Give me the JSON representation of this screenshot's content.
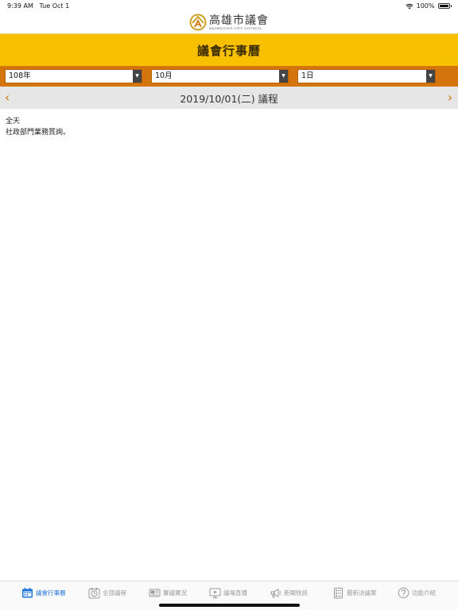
{
  "status_bar": {
    "time": "9:39 AM",
    "date": "Tue Oct 1",
    "battery": "100%"
  },
  "logo": {
    "chinese": "高雄市議會",
    "english": "KAOHSIUNG CITY COUNCIL"
  },
  "header": {
    "title": "議會行事曆"
  },
  "filters": {
    "year": "108年",
    "month": "10月",
    "day": "1日"
  },
  "date_nav": {
    "title": "2019/10/01(二) 議程",
    "prev_symbol": "‹",
    "next_symbol": "›"
  },
  "schedule": {
    "time": "全天",
    "item": "社政部門業務質詢。"
  },
  "tabs": [
    {
      "label": "議會行事曆",
      "icon": "calendar-icon",
      "active": true
    },
    {
      "label": "全部議程",
      "icon": "clock-icon",
      "active": false
    },
    {
      "label": "審議實況",
      "icon": "video-icon",
      "active": false
    },
    {
      "label": "議場直播",
      "icon": "monitor-icon",
      "active": false
    },
    {
      "label": "新聞快訊",
      "icon": "megaphone-icon",
      "active": false
    },
    {
      "label": "最新決議案",
      "icon": "document-icon",
      "active": false
    },
    {
      "label": "功能介紹",
      "icon": "question-icon",
      "active": false
    }
  ],
  "colors": {
    "accent_yellow": "#f7c000",
    "accent_orange": "#d4740c",
    "active_tab": "#1a73d9"
  }
}
